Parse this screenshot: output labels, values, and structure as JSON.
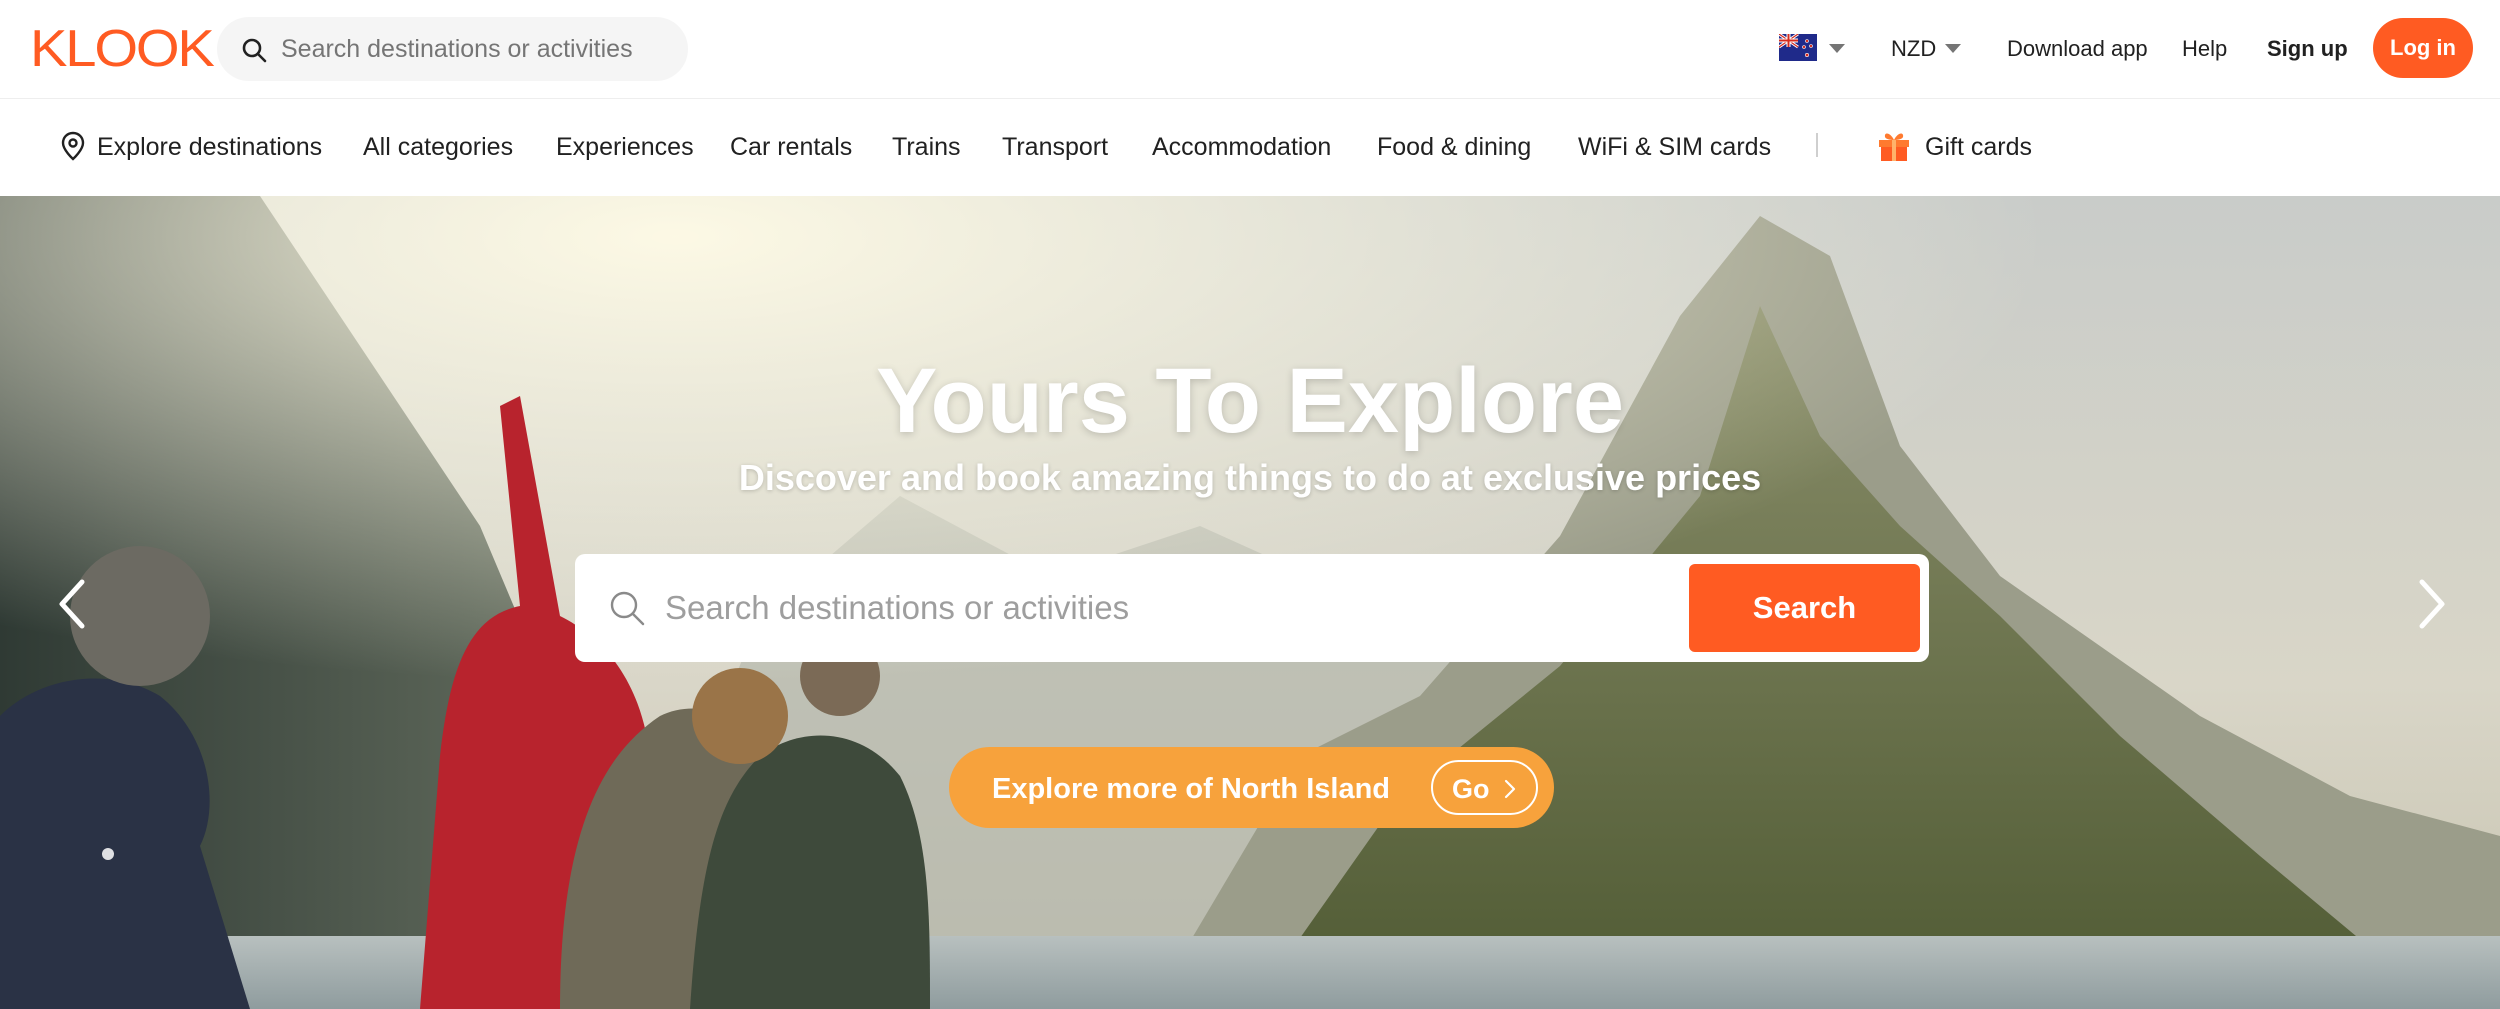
{
  "header": {
    "logo_text": "KLOOK",
    "search_placeholder": "Search destinations or activities",
    "currency": "NZD",
    "links": {
      "download_app": "Download app",
      "help": "Help",
      "sign_up": "Sign up"
    },
    "login_label": "Log in"
  },
  "nav": {
    "explore_destinations": "Explore destinations",
    "categories": [
      "All categories",
      "Experiences",
      "Car rentals",
      "Trains",
      "Transport",
      "Accommodation",
      "Food & dining",
      "WiFi & SIM cards"
    ],
    "gift_cards": "Gift cards"
  },
  "hero": {
    "title": "Yours To Explore",
    "subtitle": "Discover and book amazing things to do at exclusive prices",
    "search_placeholder": "Search destinations or activities",
    "search_button": "Search",
    "promo_text": "Explore more of North Island",
    "promo_button": "Go"
  },
  "colors": {
    "brand": "#ff5b22",
    "promo": "#f7a23c"
  },
  "icons": [
    "search-icon",
    "flag-nz-icon",
    "chevron-down-icon",
    "location-pin-icon",
    "gift-icon",
    "chevron-left-icon",
    "chevron-right-icon"
  ]
}
